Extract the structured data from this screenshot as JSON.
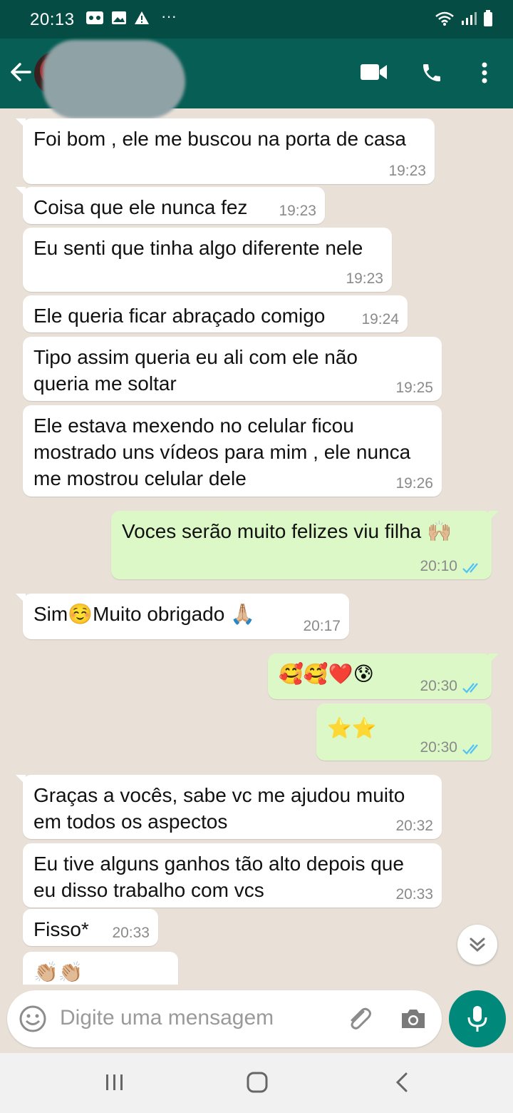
{
  "status_bar": {
    "time": "20:13",
    "more": "···"
  },
  "header": {
    "contact_name": ""
  },
  "messages": [
    {
      "dir": "in",
      "text": "Foi bom , ele me buscou na porta de casa",
      "time": "19:23"
    },
    {
      "dir": "in",
      "text": "Coisa que ele nunca fez",
      "time": "19:23"
    },
    {
      "dir": "in",
      "text": "Eu senti que tinha algo diferente nele",
      "time": "19:23"
    },
    {
      "dir": "in",
      "text": "Ele queria ficar abraçado comigo",
      "time": "19:24"
    },
    {
      "dir": "in",
      "text": "Tipo assim queria eu ali com ele não\nqueria me soltar",
      "time": "19:25"
    },
    {
      "dir": "in",
      "text": "Ele estava mexendo no celular ficou\nmostrado uns vídeos para mim , ele nunca\nme mostrou celular dele",
      "time": "19:26"
    },
    {
      "dir": "out",
      "text": "Voces serão muito felizes viu filha 🙌🏼",
      "time": "20:10",
      "status": "read"
    },
    {
      "dir": "in",
      "text": "Sim☺️Muito obrigado 🙏🏼",
      "time": "20:17"
    },
    {
      "dir": "out",
      "text": "🥰🥰❤️😰",
      "time": "20:30",
      "status": "read"
    },
    {
      "dir": "out",
      "text": "⭐⭐",
      "time": "20:30",
      "status": "read"
    },
    {
      "dir": "in",
      "text": "Graças a vocês, sabe vc me ajudou muito\nem todos os aspectos",
      "time": "20:32"
    },
    {
      "dir": "in",
      "text": "Eu tive alguns ganhos tão alto depois que\neu disso trabalho com vcs",
      "time": "20:33"
    },
    {
      "dir": "in",
      "text": "Fisso*",
      "time": "20:33"
    },
    {
      "dir": "in",
      "text": "👏🏼👏🏼",
      "time": ""
    }
  ],
  "composer": {
    "placeholder": "Digite uma mensagem"
  },
  "colors": {
    "header": "#075e54",
    "status_bar": "#054d44",
    "outgoing_bubble": "#dcf8c6",
    "read_tick": "#4fc3f7",
    "mic_button": "#00897b"
  }
}
